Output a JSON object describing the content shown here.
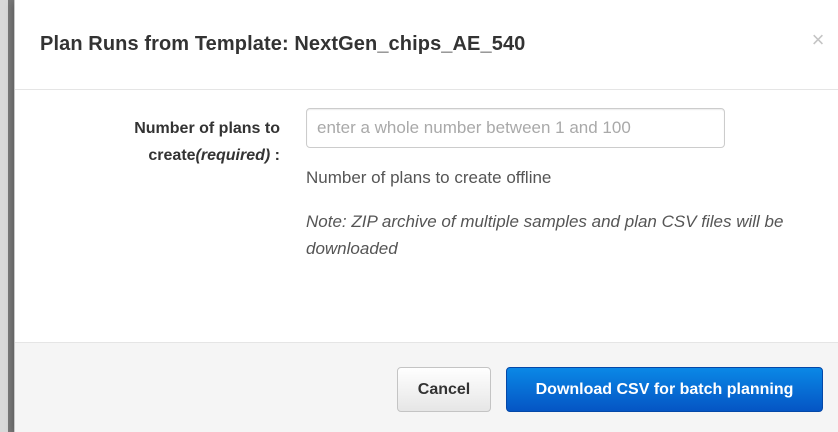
{
  "dialog": {
    "title": "Plan Runs from Template: NextGen_chips_AE_540",
    "close_symbol": "×"
  },
  "form": {
    "label_main": "Number of plans to create",
    "label_required": "(required)",
    "label_suffix": " :",
    "input_value": "",
    "input_placeholder": "enter a whole number between 1 and 100",
    "help_text": "Number of plans to create offline",
    "note_text": "Note: ZIP archive of multiple samples and plan CSV files will be downloaded"
  },
  "footer": {
    "cancel_label": "Cancel",
    "primary_label": "Download CSV for batch planning"
  },
  "colors": {
    "primary": "#0866d6",
    "title": "#333333",
    "text": "#555555"
  }
}
